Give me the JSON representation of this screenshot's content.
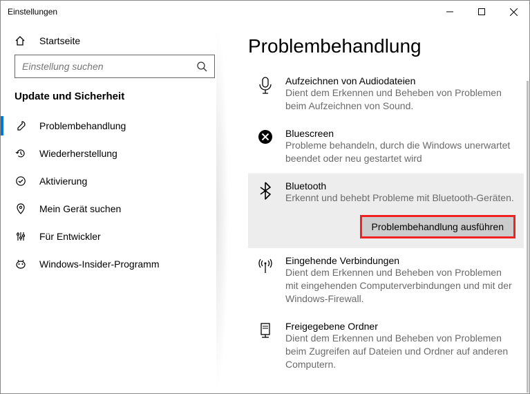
{
  "window": {
    "title": "Einstellungen"
  },
  "sidebar": {
    "home": "Startseite",
    "search_placeholder": "Einstellung suchen",
    "section": "Update und Sicherheit",
    "items": [
      {
        "label": "Problembehandlung"
      },
      {
        "label": "Wiederherstellung"
      },
      {
        "label": "Aktivierung"
      },
      {
        "label": "Mein Gerät suchen"
      },
      {
        "label": "Für Entwickler"
      },
      {
        "label": "Windows-Insider-Programm"
      }
    ]
  },
  "main": {
    "heading": "Problembehandlung",
    "troubleshooters": [
      {
        "title": "Aufzeichnen von Audiodateien",
        "desc": "Dient dem Erkennen und Beheben von Problemen beim Aufzeichnen von Sound."
      },
      {
        "title": "Bluescreen",
        "desc": "Probleme behandeln, durch die Windows unerwartet beendet oder neu gestartet wird"
      },
      {
        "title": "Bluetooth",
        "desc": "Erkennt und behebt Probleme mit Bluetooth-Geräten.",
        "run_label": "Problembehandlung ausführen"
      },
      {
        "title": "Eingehende Verbindungen",
        "desc": "Dient dem Erkennen und Beheben von Problemen mit eingehenden Computerverbindungen und mit der Windows-Firewall."
      },
      {
        "title": "Freigegebene Ordner",
        "desc": "Dient dem Erkennen und Beheben von Problemen beim Zugreifen auf Dateien und Ordner auf anderen Computern."
      }
    ]
  }
}
